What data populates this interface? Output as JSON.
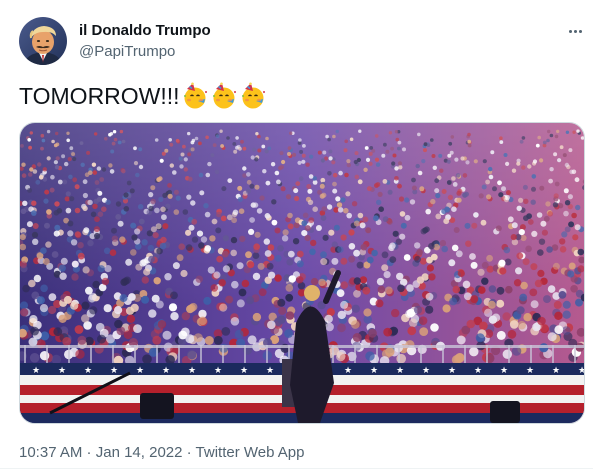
{
  "user": {
    "display_name": "il Donaldo Trumpo",
    "handle": "@PapiTrumpo"
  },
  "tweet": {
    "text": "TOMORROW!!!",
    "emojis": [
      "partying-face-emoji",
      "partying-face-emoji",
      "partying-face-emoji"
    ]
  },
  "media": {
    "icon": "crowd-rally-photo"
  },
  "meta": {
    "time": "10:37 AM",
    "separator": " · ",
    "date": "Jan 14, 2022",
    "source": "Twitter Web App"
  },
  "colors": {
    "text_primary": "#0f1419",
    "text_secondary": "#536471",
    "border": "#cfd9de"
  },
  "more_icon": "more-horizontal-icon"
}
